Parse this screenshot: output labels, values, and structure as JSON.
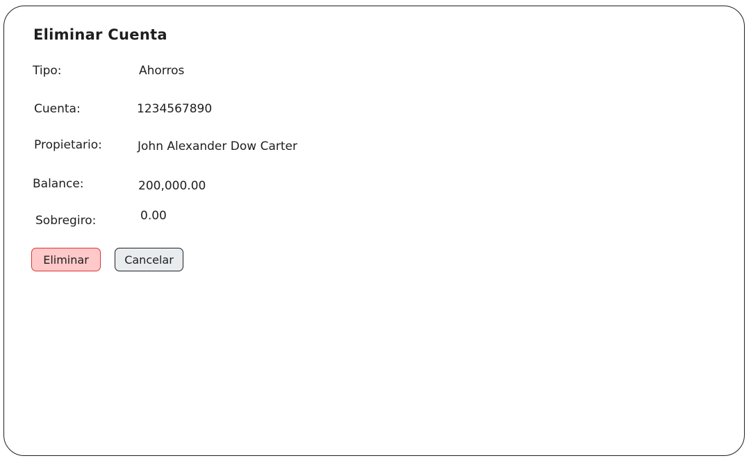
{
  "dialog": {
    "title": "Eliminar Cuenta",
    "fields": [
      {
        "label": "Tipo:",
        "value": "Ahorros"
      },
      {
        "label": "Cuenta:",
        "value": "1234567890"
      },
      {
        "label": "Propietario:",
        "value": "John Alexander Dow Carter"
      },
      {
        "label": "Balance:",
        "value": "200,000.00"
      },
      {
        "label": "Sobregiro:",
        "value": "0.00"
      }
    ]
  },
  "buttons": {
    "delete_label": "Eliminar",
    "cancel_label": "Cancelar"
  },
  "colors": {
    "delete_fill": "#ffc9c9",
    "delete_stroke": "#e03131",
    "cancel_fill": "#e9ecef",
    "stroke": "#1e1e1e"
  }
}
